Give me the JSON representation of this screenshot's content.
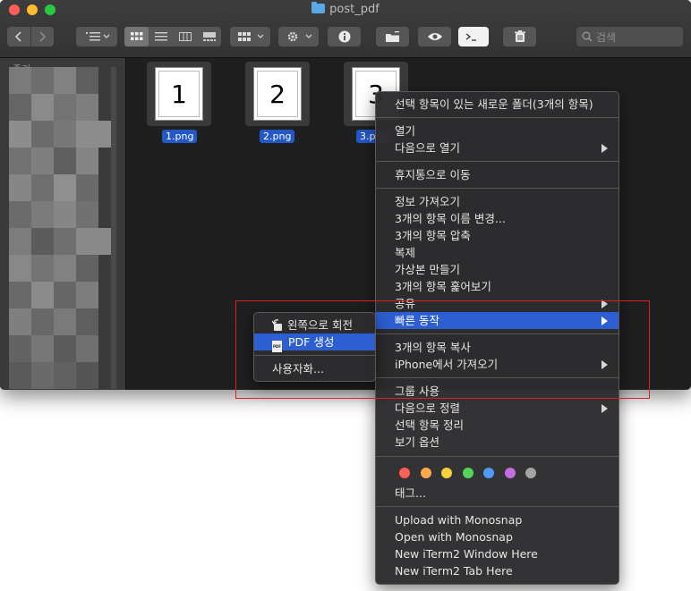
{
  "window": {
    "title": "post_pdf"
  },
  "toolbar": {
    "back_icon": "chevron-left-icon",
    "forward_icon": "chevron-right-icon",
    "search_placeholder": "검색"
  },
  "sidebar": {
    "heading_partial": "즐겨찾기"
  },
  "files": [
    {
      "name": "1.png",
      "thumb_text": "1"
    },
    {
      "name": "2.png",
      "thumb_text": "2"
    },
    {
      "name": "3.png",
      "thumb_text": "3"
    }
  ],
  "context_menu": {
    "new_folder": "선택 항목이 있는 새로운 폴더(3개의 항목)",
    "open": "열기",
    "open_with": "다음으로 열기",
    "move_to_trash": "휴지통으로 이동",
    "get_info": "정보 가져오기",
    "rename": "3개의 항목 이름 변경...",
    "compress": "3개의 항목 압축",
    "duplicate": "복제",
    "make_alias": "가상본 만들기",
    "quick_look": "3개의 항목 훑어보기",
    "share": "공유",
    "quick_actions": "빠른 동작",
    "copy": "3개의 항목 복사",
    "import_iphone": "iPhone에서 가져오기",
    "use_groups": "그룹 사용",
    "sort_by": "다음으로 정렬",
    "clean_up": "선택 항목 정리",
    "view_options": "보기 옵션",
    "tags_label": "태그...",
    "tag_colors": [
      "#ff5f57",
      "#ffa94a",
      "#f5d23a",
      "#54d45a",
      "#4c9bf5",
      "#c36de0",
      "#a4a4a4"
    ],
    "upload_monosnap": "Upload with Monosnap",
    "open_monosnap": "Open with Monosnap",
    "iterm_window": "New iTerm2 Window Here",
    "iterm_tab": "New iTerm2 Tab Here"
  },
  "quick_actions_submenu": {
    "rotate_left": "왼쪽으로 회전",
    "create_pdf": "PDF 생성",
    "pdf_icon_text": "PDF",
    "customize": "사용자화..."
  }
}
